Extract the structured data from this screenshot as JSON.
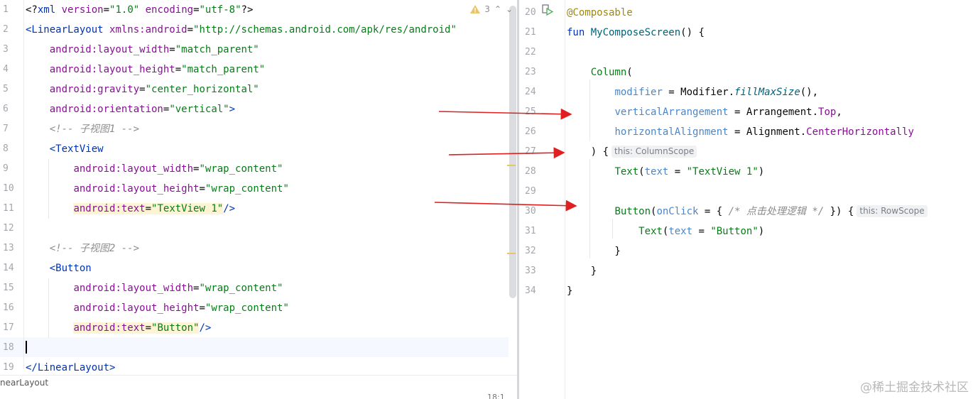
{
  "left_editor": {
    "inspection": {
      "warning_count": "3",
      "up": "⌃",
      "down": "⌄"
    },
    "breadcrumb": "nearLayout",
    "cursor_position": "18:1",
    "lines": [
      {
        "num": "1",
        "parts": [
          [
            "xml-pi",
            "<?"
          ],
          [
            "xml-tag",
            "xml "
          ],
          [
            "xml-attr",
            "version"
          ],
          [
            "xml-pi",
            "="
          ],
          [
            "xml-val",
            "\"1.0\""
          ],
          [
            "xml-pi",
            " "
          ],
          [
            "xml-attr",
            "encoding"
          ],
          [
            "xml-pi",
            "="
          ],
          [
            "xml-val",
            "\"utf-8\""
          ],
          [
            "xml-pi",
            "?>"
          ]
        ]
      },
      {
        "num": "2",
        "parts": [
          [
            "xml-tag",
            "<LinearLayout "
          ],
          [
            "xml-attr",
            "xmlns:android"
          ],
          [
            "xml-pi",
            "="
          ],
          [
            "xml-val",
            "\"http://schemas.android.com/apk/res/android\""
          ]
        ]
      },
      {
        "num": "3",
        "parts": [
          [
            "xml-pi",
            "    "
          ],
          [
            "xml-attr",
            "android:layout_width"
          ],
          [
            "xml-pi",
            "="
          ],
          [
            "xml-val",
            "\"match_parent\""
          ]
        ]
      },
      {
        "num": "4",
        "parts": [
          [
            "xml-pi",
            "    "
          ],
          [
            "xml-attr",
            "android:layout_height"
          ],
          [
            "xml-pi",
            "="
          ],
          [
            "xml-val",
            "\"match_parent\""
          ]
        ]
      },
      {
        "num": "5",
        "parts": [
          [
            "xml-pi",
            "    "
          ],
          [
            "xml-attr",
            "android:gravity"
          ],
          [
            "xml-pi",
            "="
          ],
          [
            "xml-val",
            "\"center_horizontal\""
          ]
        ]
      },
      {
        "num": "6",
        "parts": [
          [
            "xml-pi",
            "    "
          ],
          [
            "xml-attr",
            "android:orientation"
          ],
          [
            "xml-pi",
            "="
          ],
          [
            "xml-val",
            "\"vertical\""
          ],
          [
            "xml-tag",
            ">"
          ]
        ]
      },
      {
        "num": "7",
        "parts": [
          [
            "xml-pi",
            "    "
          ],
          [
            "comment",
            "<!-- 子视图1 -->"
          ]
        ]
      },
      {
        "num": "8",
        "parts": [
          [
            "xml-pi",
            "    "
          ],
          [
            "xml-tag",
            "<TextView"
          ]
        ]
      },
      {
        "num": "9",
        "parts": [
          [
            "xml-pi",
            "        "
          ],
          [
            "xml-attr",
            "android:layout_width"
          ],
          [
            "xml-pi",
            "="
          ],
          [
            "xml-val",
            "\"wrap_content\""
          ]
        ]
      },
      {
        "num": "10",
        "parts": [
          [
            "xml-pi",
            "        "
          ],
          [
            "xml-attr",
            "android:layout_height"
          ],
          [
            "xml-pi",
            "="
          ],
          [
            "xml-val",
            "\"wrap_content\""
          ]
        ]
      },
      {
        "num": "11",
        "parts": [
          [
            "xml-pi",
            "        "
          ],
          [
            "xml-attr hl",
            "android:text"
          ],
          [
            "xml-pi hl",
            "="
          ],
          [
            "xml-val hl",
            "\"TextView 1\""
          ],
          [
            "xml-tag",
            "/>"
          ]
        ]
      },
      {
        "num": "12",
        "parts": []
      },
      {
        "num": "13",
        "parts": [
          [
            "xml-pi",
            "    "
          ],
          [
            "comment",
            "<!-- 子视图2 -->"
          ]
        ]
      },
      {
        "num": "14",
        "parts": [
          [
            "xml-pi",
            "    "
          ],
          [
            "xml-tag",
            "<Button"
          ]
        ]
      },
      {
        "num": "15",
        "parts": [
          [
            "xml-pi",
            "        "
          ],
          [
            "xml-attr",
            "android:layout_width"
          ],
          [
            "xml-pi",
            "="
          ],
          [
            "xml-val",
            "\"wrap_content\""
          ]
        ]
      },
      {
        "num": "16",
        "parts": [
          [
            "xml-pi",
            "        "
          ],
          [
            "xml-attr",
            "android:layout_height"
          ],
          [
            "xml-pi",
            "="
          ],
          [
            "xml-val",
            "\"wrap_content\""
          ]
        ]
      },
      {
        "num": "17",
        "parts": [
          [
            "xml-pi",
            "        "
          ],
          [
            "xml-attr hl",
            "android:text"
          ],
          [
            "xml-pi hl",
            "="
          ],
          [
            "xml-val hl",
            "\"Button\""
          ],
          [
            "xml-tag",
            "/>"
          ]
        ]
      },
      {
        "num": "18",
        "parts": []
      },
      {
        "num": "19",
        "parts": [
          [
            "xml-tag",
            "</LinearLayout>"
          ]
        ]
      }
    ]
  },
  "right_editor": {
    "lines": [
      {
        "num": "20",
        "parts": [
          [
            "ann",
            "@Composable"
          ]
        ]
      },
      {
        "num": "21",
        "parts": [
          [
            "kw",
            "fun "
          ],
          [
            "fn-call",
            "MyComposeScreen"
          ],
          [
            "xml-pi",
            "() {"
          ]
        ]
      },
      {
        "num": "22",
        "parts": []
      },
      {
        "num": "23",
        "parts": [
          [
            "xml-pi",
            "    "
          ],
          [
            "compose",
            "Column"
          ],
          [
            "xml-pi",
            "("
          ]
        ]
      },
      {
        "num": "24",
        "parts": [
          [
            "xml-pi",
            "        "
          ],
          [
            "param",
            "modifier"
          ],
          [
            "xml-pi",
            " = Modifier."
          ],
          [
            "italic-fn",
            "fillMaxSize"
          ],
          [
            "xml-pi",
            "(),"
          ]
        ]
      },
      {
        "num": "25",
        "parts": [
          [
            "xml-pi",
            "        "
          ],
          [
            "param",
            "verticalArrangement"
          ],
          [
            "xml-pi",
            " = Arrangement."
          ],
          [
            "prop",
            "Top"
          ],
          [
            "xml-pi",
            ","
          ]
        ]
      },
      {
        "num": "26",
        "parts": [
          [
            "xml-pi",
            "        "
          ],
          [
            "param",
            "horizontalAlignment"
          ],
          [
            "xml-pi",
            " = Alignment."
          ],
          [
            "prop",
            "CenterHorizontally"
          ]
        ]
      },
      {
        "num": "27",
        "parts": [
          [
            "xml-pi",
            "    ) {"
          ]
        ],
        "hint": "this: ColumnScope"
      },
      {
        "num": "28",
        "parts": [
          [
            "xml-pi",
            "        "
          ],
          [
            "compose",
            "Text"
          ],
          [
            "xml-pi",
            "("
          ],
          [
            "param",
            "text"
          ],
          [
            "xml-pi",
            " = "
          ],
          [
            "str",
            "\"TextView 1\""
          ],
          [
            "xml-pi",
            ")"
          ]
        ]
      },
      {
        "num": "29",
        "parts": []
      },
      {
        "num": "30",
        "parts": [
          [
            "xml-pi",
            "        "
          ],
          [
            "compose",
            "Button"
          ],
          [
            "xml-pi",
            "("
          ],
          [
            "param",
            "onClick"
          ],
          [
            "xml-pi",
            " = { "
          ],
          [
            "comment",
            "/* 点击处理逻辑 */"
          ],
          [
            "xml-pi",
            " }) {"
          ]
        ],
        "hint": "this: RowScope"
      },
      {
        "num": "31",
        "parts": [
          [
            "xml-pi",
            "            "
          ],
          [
            "compose",
            "Text"
          ],
          [
            "xml-pi",
            "("
          ],
          [
            "param",
            "text"
          ],
          [
            "xml-pi",
            " = "
          ],
          [
            "str",
            "\"Button\""
          ],
          [
            "xml-pi",
            ")"
          ]
        ]
      },
      {
        "num": "32",
        "parts": [
          [
            "xml-pi",
            "        }"
          ]
        ]
      },
      {
        "num": "33",
        "parts": [
          [
            "xml-pi",
            "    }"
          ]
        ]
      },
      {
        "num": "34",
        "parts": [
          [
            "xml-pi",
            "}"
          ]
        ]
      }
    ]
  },
  "watermark": "@稀土掘金技术社区",
  "colors": {
    "arrow": "#e02020",
    "caret_line": "#f5f8fe",
    "warning": "#e9c46a"
  }
}
